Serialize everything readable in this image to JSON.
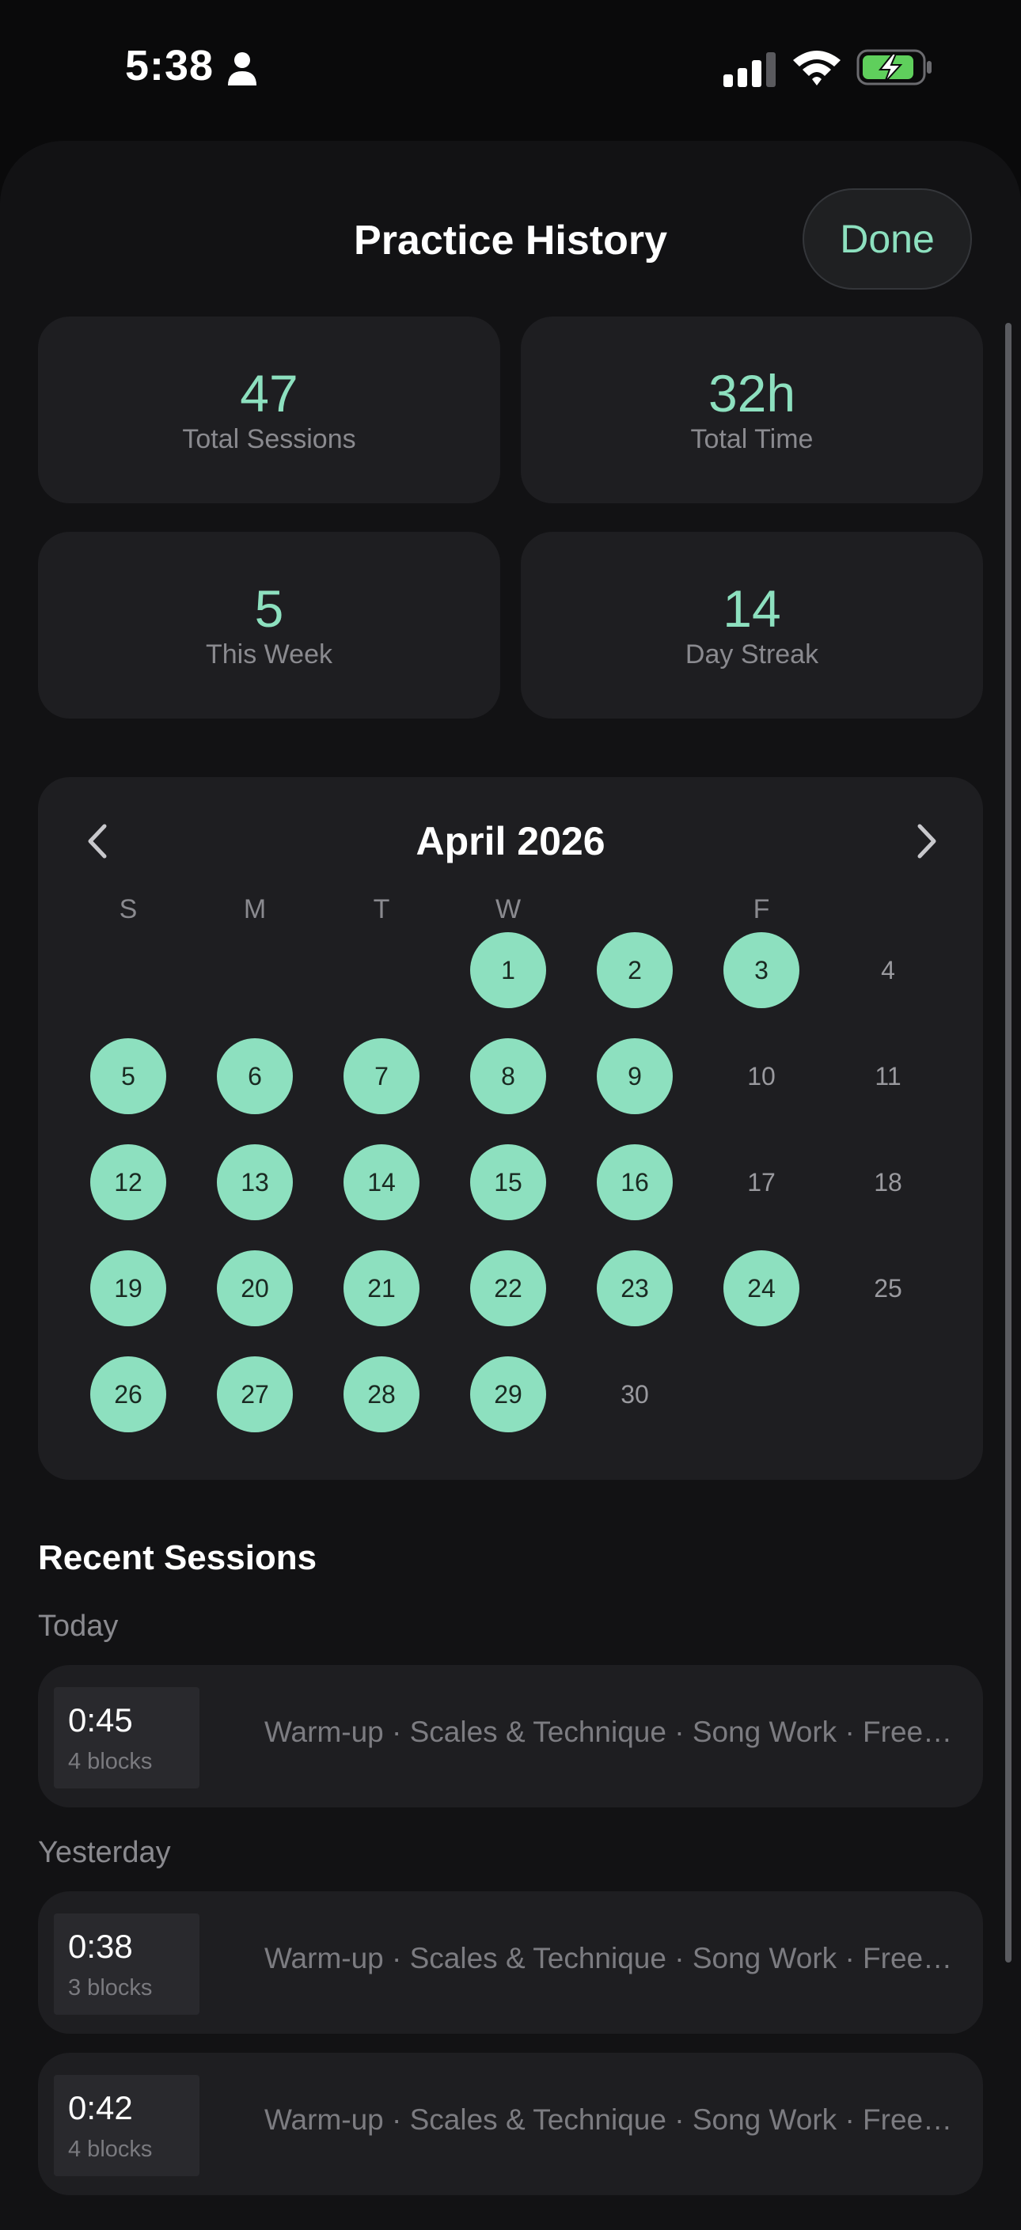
{
  "status_bar": {
    "time": "5:38"
  },
  "header": {
    "title": "Practice History",
    "done_label": "Done"
  },
  "stats": [
    {
      "value": "47",
      "label": "Total Sessions"
    },
    {
      "value": "32h",
      "label": "Total Time"
    },
    {
      "value": "5",
      "label": "This Week"
    },
    {
      "value": "14",
      "label": "Day Streak"
    }
  ],
  "calendar": {
    "month": "April 2026",
    "weekdays": [
      "S",
      "M",
      "T",
      "W",
      "",
      "F",
      ""
    ],
    "days": [
      {
        "n": "1",
        "on": true
      },
      {
        "n": "2",
        "on": true
      },
      {
        "n": "3",
        "on": true
      },
      {
        "n": "4",
        "on": false
      },
      {
        "n": "5",
        "on": true
      },
      {
        "n": "6",
        "on": true
      },
      {
        "n": "7",
        "on": true
      },
      {
        "n": "8",
        "on": true
      },
      {
        "n": "9",
        "on": true
      },
      {
        "n": "10",
        "on": false
      },
      {
        "n": "11",
        "on": false
      },
      {
        "n": "12",
        "on": true
      },
      {
        "n": "13",
        "on": true
      },
      {
        "n": "14",
        "on": true
      },
      {
        "n": "15",
        "on": true
      },
      {
        "n": "16",
        "on": true
      },
      {
        "n": "17",
        "on": false
      },
      {
        "n": "18",
        "on": false
      },
      {
        "n": "19",
        "on": true
      },
      {
        "n": "20",
        "on": true
      },
      {
        "n": "21",
        "on": true
      },
      {
        "n": "22",
        "on": true
      },
      {
        "n": "23",
        "on": true
      },
      {
        "n": "24",
        "on": true
      },
      {
        "n": "25",
        "on": false
      },
      {
        "n": "26",
        "on": true
      },
      {
        "n": "27",
        "on": true
      },
      {
        "n": "28",
        "on": true
      },
      {
        "n": "29",
        "on": true
      },
      {
        "n": "30",
        "on": false
      }
    ]
  },
  "recent": {
    "title": "Recent Sessions",
    "groups": [
      {
        "label": "Today",
        "sessions": [
          {
            "duration": "0:45",
            "blocks": "4 blocks",
            "desc": "Warm-up · Scales & Technique · Song Work · Free…"
          }
        ]
      },
      {
        "label": "Yesterday",
        "sessions": [
          {
            "duration": "0:38",
            "blocks": "3 blocks",
            "desc": "Warm-up · Scales & Technique · Song Work · Free…"
          },
          {
            "duration": "0:42",
            "blocks": "4 blocks",
            "desc": "Warm-up · Scales & Technique · Song Work · Free…"
          }
        ]
      }
    ]
  },
  "colors": {
    "accent": "#8de0bf",
    "card": "#1e1e21",
    "sheet": "#121214"
  }
}
